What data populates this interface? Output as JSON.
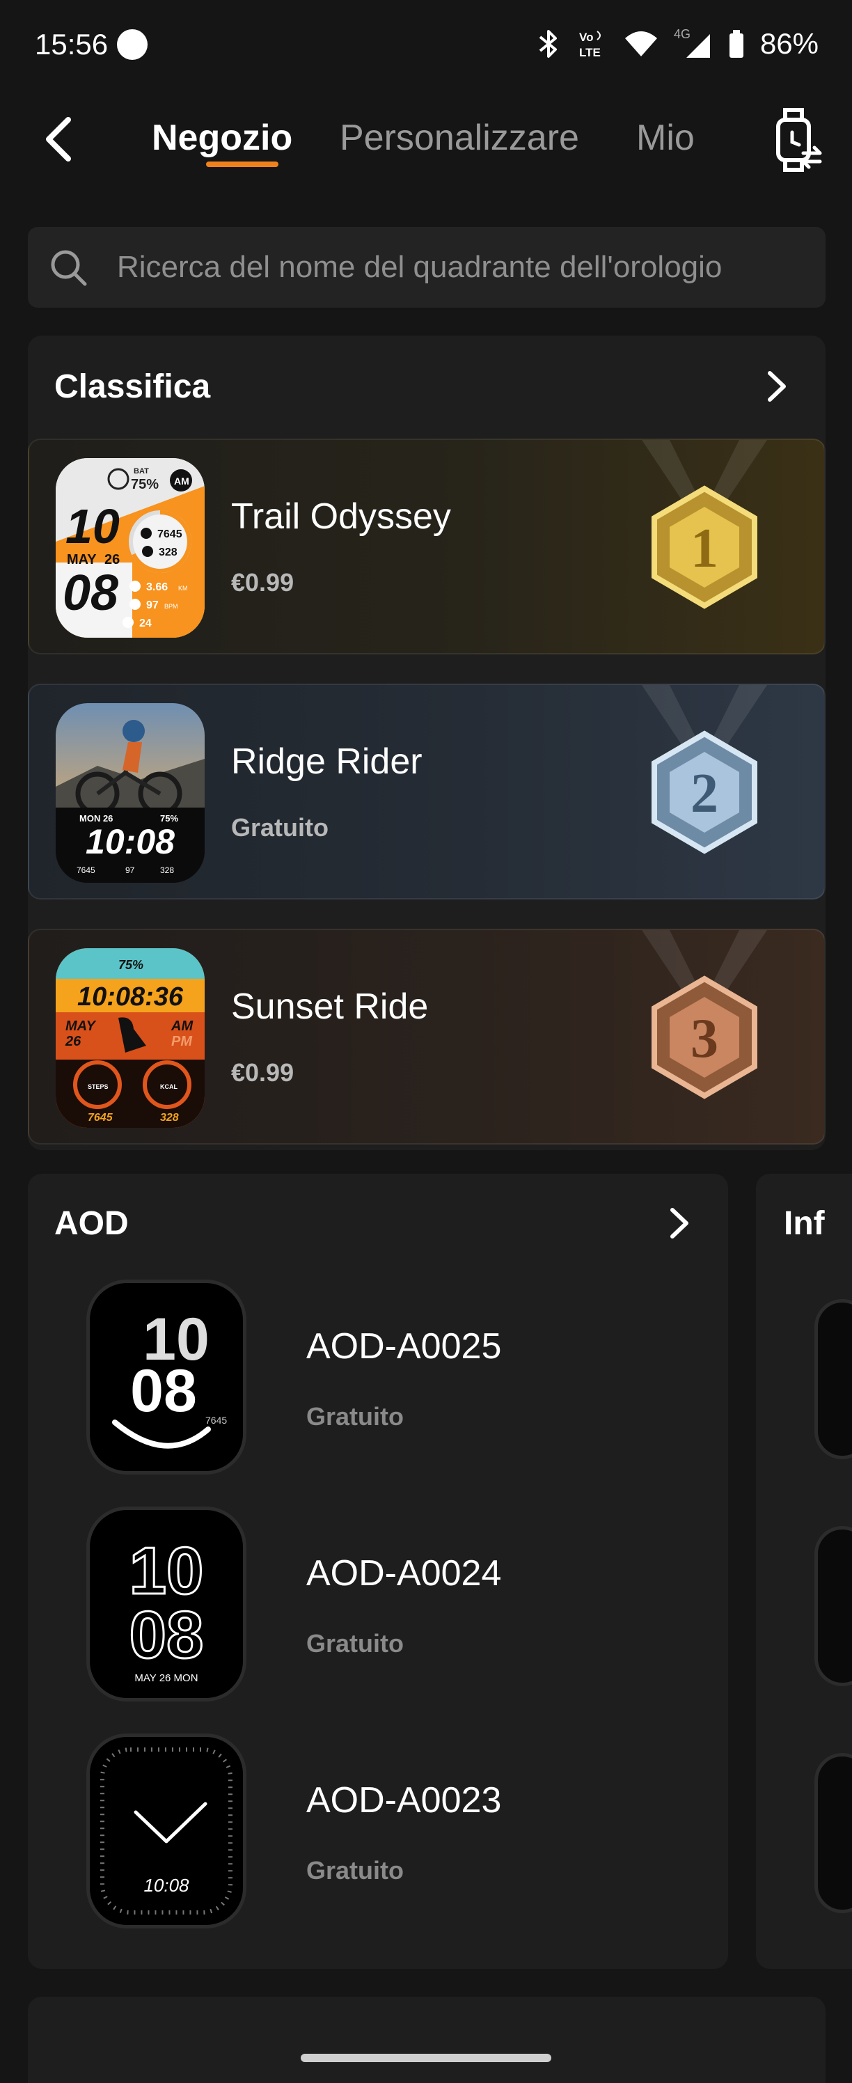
{
  "status_bar": {
    "time": "15:56",
    "battery": "86%",
    "network": "4G",
    "volte": "Vo LTE"
  },
  "header": {
    "tabs": [
      {
        "label": "Negozio",
        "active": true
      },
      {
        "label": "Personalizzare",
        "active": false
      },
      {
        "label": "Mio",
        "active": false
      }
    ]
  },
  "search": {
    "placeholder": "Ricerca del nome del quadrante dell'orologio"
  },
  "ranking": {
    "title": "Classifica",
    "items": [
      {
        "rank": "1",
        "name": "Trail Odyssey",
        "price": "€0.99",
        "medal": "gold",
        "face": {
          "bat_label": "BAT",
          "battery": "75%",
          "am": "AM",
          "hour": "10",
          "month": "MAY",
          "day": "26",
          "minute": "08",
          "steps": "7645",
          "kcal": "328",
          "dist": "3.66",
          "dist_unit": "KM",
          "bpm": "97",
          "bpm_unit": "BPM",
          "temp": "24"
        }
      },
      {
        "rank": "2",
        "name": "Ridge Rider",
        "price": "Gratuito",
        "medal": "silver",
        "face": {
          "date": "MON 26",
          "battery": "75%",
          "time": "10:08",
          "steps": "7645",
          "bpm": "97",
          "kcal": "328"
        }
      },
      {
        "rank": "3",
        "name": "Sunset Ride",
        "price": "€0.99",
        "medal": "bronze",
        "face": {
          "battery": "75%",
          "time": "10:08:36",
          "month": "MAY",
          "day": "26",
          "am": "AM",
          "pm": "PM",
          "steps_label": "STEPS",
          "kcal_label": "KCAL",
          "steps": "7645",
          "kcal": "328"
        }
      }
    ]
  },
  "aod": {
    "title": "AOD",
    "items": [
      {
        "name": "AOD-A0025",
        "price": "Gratuito",
        "face": {
          "hour": "10",
          "minute": "08",
          "steps": "7645"
        }
      },
      {
        "name": "AOD-A0024",
        "price": "Gratuito",
        "face": {
          "hour": "10",
          "minute": "08",
          "date": "MAY   26   MON"
        }
      },
      {
        "name": "AOD-A0023",
        "price": "Gratuito",
        "face": {
          "time": "10:08"
        }
      }
    ]
  },
  "next_section": {
    "title_partial": "Inf"
  },
  "colors": {
    "accent": "#f0821e",
    "background": "#151515",
    "panel": "#1e1e1e",
    "gold": "#e3c24a",
    "silver": "#9fc0dc",
    "bronze": "#d0906a"
  }
}
